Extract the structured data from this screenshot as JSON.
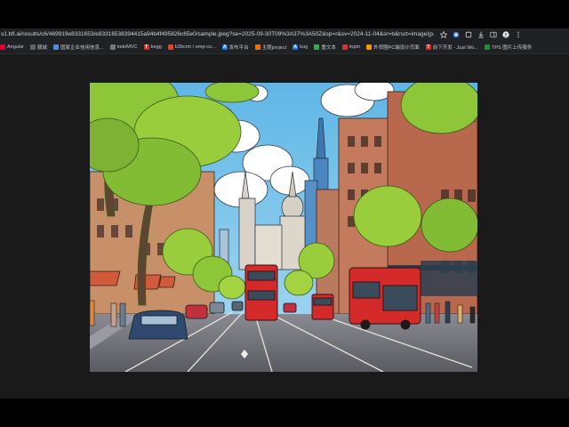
{
  "browser": {
    "url": "s1.bfl.ai/results/c6/469919e8331653/e83316538394415a94b4f495826c65e0/sample.jpeg?se=2025-09-30T09%3A37%3A50Z&sp=r&sv=2024-11-04&sr=b&rsct=image/jp...",
    "toolbar_icons": [
      "star-icon",
      "extension-icon",
      "puzzle-icon",
      "download-icon",
      "sidebar-icon",
      "profile-icon",
      "menu-icon"
    ]
  },
  "bookmarks": [
    {
      "label": "Angular",
      "icon": "angular-icon",
      "color": "#dd0031",
      "glyph": ""
    },
    {
      "label": "靓城",
      "icon": "folder-icon",
      "color": "#5f6368",
      "glyph": ""
    },
    {
      "label": "国家企业信用信息...",
      "icon": "globe-icon",
      "color": "#4a90d9",
      "glyph": ""
    },
    {
      "label": "todoMVC",
      "icon": "todo-icon",
      "color": "#777777",
      "glyph": ""
    },
    {
      "label": "begg",
      "icon": "t-icon",
      "color": "#d93025",
      "glyph": "T"
    },
    {
      "label": "b2bcrm / emp-co...",
      "icon": "gitlab-icon",
      "color": "#e24329",
      "glyph": ""
    },
    {
      "label": "发布平台",
      "icon": "a-icon",
      "color": "#1a73e8",
      "glyph": "A"
    },
    {
      "label": "主题project",
      "icon": "app-icon",
      "color": "#e37400",
      "glyph": ""
    },
    {
      "label": "bug",
      "icon": "a-icon",
      "color": "#1a73e8",
      "glyph": "A"
    },
    {
      "label": "重文本",
      "icon": "doc-icon",
      "color": "#34a853",
      "glyph": ""
    },
    {
      "label": "tnpm",
      "icon": "npm-icon",
      "color": "#cb3837",
      "glyph": ""
    },
    {
      "label": "外贸圈PC端设计页面",
      "icon": "design-icon",
      "color": "#f29900",
      "glyph": ""
    },
    {
      "label": "前下开发 - Just Wo...",
      "icon": "t-icon",
      "color": "#d93025",
      "glyph": "T"
    },
    {
      "label": "TPS 图片上传服务",
      "icon": "upload-icon",
      "color": "#1e8e3e",
      "glyph": ""
    }
  ],
  "image": {
    "description_icon": "city-street-illustration-image",
    "colors": {
      "sky": "#7fc6ea",
      "bus_red": "#d42a2a",
      "tree_green": "#8fc63a",
      "building_brick": "#b86a4e",
      "road": "#6e6d73"
    }
  }
}
